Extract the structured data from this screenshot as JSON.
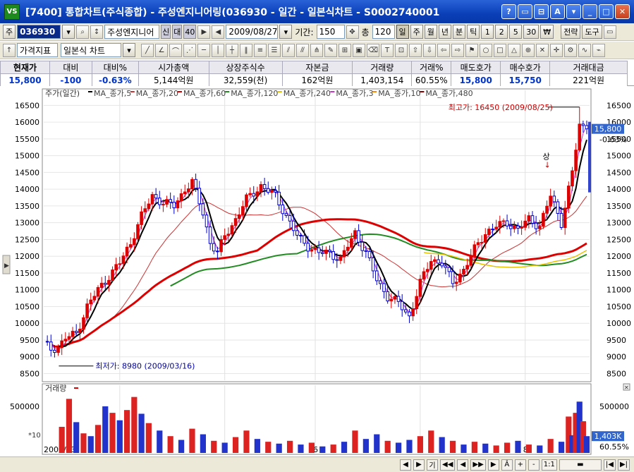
{
  "window": {
    "logo": "VS",
    "title": "[7400] 통합차트(주식종합) - 주성엔지니어링(036930 - 일간 - 일본식차트 - S0002740001",
    "buttons": [
      "?",
      "▭",
      "⊟",
      "A",
      "▾",
      "_",
      "□",
      "✕"
    ]
  },
  "toolbar1": {
    "market": "주",
    "code": "036930",
    "stock_name": "주성엔지니어",
    "tag1": "신",
    "tag2": "대",
    "tag3": "40",
    "date": "2009/08/27",
    "period_label": "기간:",
    "period_value": "150",
    "count_label": "총",
    "count_value": "120",
    "periods": [
      "일",
      "주",
      "월",
      "년",
      "분",
      "틱"
    ],
    "selected_period": "일",
    "minutes": [
      "1",
      "2",
      "5",
      "30"
    ],
    "currency": "₩",
    "strategy": "전략",
    "tools": "도구"
  },
  "toolbar2": {
    "indicator": "가격지표",
    "chart_type": "일본식 차트"
  },
  "info": {
    "headers": [
      "현재가",
      "대비",
      "대비%",
      "시가총액",
      "상장주식수",
      "자본금",
      "거래량",
      "거래%",
      "매도호가",
      "매수호가",
      "거래대금"
    ],
    "values": [
      "15,800",
      "-100",
      "-0.63%",
      "5,144억원",
      "32,559(천)",
      "162억원",
      "1,403,154",
      "60.55%",
      "15,800",
      "15,750",
      "221억원"
    ]
  },
  "chart_data": {
    "type": "candlestick",
    "title": "주가(일간)",
    "legend": [
      {
        "name": "MA_종가,5",
        "color": "#000000"
      },
      {
        "name": "MA_종가,20",
        "color": "#cc3333"
      },
      {
        "name": "MA_종가,60",
        "color": "#dd0000"
      },
      {
        "name": "MA_종가,120",
        "color": "#228b22"
      },
      {
        "name": "MA_종가,240",
        "color": "#e6c200"
      },
      {
        "name": "MA_종가,3",
        "color": "#cc33cc"
      },
      {
        "name": "MA_종가,10",
        "color": "#ff8800"
      },
      {
        "name": "MA_종가,480",
        "color": "#880000"
      }
    ],
    "y_ticks": [
      8500,
      9000,
      9500,
      10000,
      10500,
      11000,
      11500,
      12000,
      12500,
      13000,
      13500,
      14000,
      14500,
      15000,
      15500,
      16000,
      16500
    ],
    "y_range": [
      8300,
      16950
    ],
    "x_labels": [
      "2009/03",
      "4",
      "5",
      "6",
      "7",
      "8"
    ],
    "x_label_days": [
      0,
      21,
      50,
      75,
      104,
      133
    ],
    "day_count": 150,
    "high_label": "최고가: 16450 (2009/08/25)",
    "high_value": 16450,
    "high_day": 148,
    "low_label": "최저가: 8980 (2009/03/16)",
    "low_value": 8980,
    "low_day": 3,
    "current_price": "15,800",
    "current_value": 15800,
    "current_change": "-0.63%",
    "signal_label": "상",
    "anchors": [
      [
        0,
        9400
      ],
      [
        3,
        9150
      ],
      [
        6,
        9550
      ],
      [
        9,
        9700
      ],
      [
        12,
        10500
      ],
      [
        15,
        11000
      ],
      [
        18,
        11400
      ],
      [
        21,
        11800
      ],
      [
        24,
        12400
      ],
      [
        27,
        13200
      ],
      [
        30,
        13800
      ],
      [
        33,
        13600
      ],
      [
        36,
        13500
      ],
      [
        39,
        14000
      ],
      [
        41,
        14200
      ],
      [
        44,
        13300
      ],
      [
        46,
        12400
      ],
      [
        48,
        12100
      ],
      [
        50,
        12600
      ],
      [
        53,
        13100
      ],
      [
        56,
        13700
      ],
      [
        60,
        14100
      ],
      [
        64,
        13800
      ],
      [
        67,
        13200
      ],
      [
        70,
        12600
      ],
      [
        73,
        12300
      ],
      [
        76,
        12100
      ],
      [
        79,
        12100
      ],
      [
        82,
        11900
      ],
      [
        86,
        12700
      ],
      [
        89,
        12100
      ],
      [
        92,
        11300
      ],
      [
        95,
        10800
      ],
      [
        98,
        10600
      ],
      [
        101,
        10200
      ],
      [
        104,
        11200
      ],
      [
        107,
        11900
      ],
      [
        110,
        11800
      ],
      [
        113,
        11200
      ],
      [
        116,
        11600
      ],
      [
        119,
        12200
      ],
      [
        122,
        12700
      ],
      [
        125,
        12900
      ],
      [
        128,
        13000
      ],
      [
        131,
        12800
      ],
      [
        134,
        13100
      ],
      [
        137,
        12900
      ],
      [
        140,
        13800
      ],
      [
        143,
        13000
      ],
      [
        146,
        14500
      ],
      [
        148,
        15900
      ],
      [
        150,
        15800
      ]
    ],
    "volume": {
      "title": "거래량",
      "y_ticks": [
        500000
      ],
      "current": "1,403K",
      "ratio": "60.55%",
      "axis_max": 620000,
      "bars": [
        [
          5,
          280000,
          1
        ],
        [
          7,
          580000,
          1
        ],
        [
          9,
          330000,
          0
        ],
        [
          11,
          210000,
          1
        ],
        [
          13,
          180000,
          0
        ],
        [
          15,
          300000,
          1
        ],
        [
          17,
          500000,
          0
        ],
        [
          19,
          430000,
          1
        ],
        [
          21,
          350000,
          0
        ],
        [
          23,
          460000,
          1
        ],
        [
          25,
          600000,
          1
        ],
        [
          27,
          420000,
          0
        ],
        [
          29,
          320000,
          1
        ],
        [
          32,
          240000,
          0
        ],
        [
          35,
          180000,
          1
        ],
        [
          38,
          140000,
          0
        ],
        [
          41,
          260000,
          1
        ],
        [
          44,
          200000,
          0
        ],
        [
          47,
          130000,
          1
        ],
        [
          50,
          110000,
          0
        ],
        [
          53,
          170000,
          1
        ],
        [
          56,
          240000,
          1
        ],
        [
          59,
          150000,
          0
        ],
        [
          62,
          120000,
          1
        ],
        [
          65,
          100000,
          0
        ],
        [
          68,
          130000,
          1
        ],
        [
          71,
          90000,
          0
        ],
        [
          74,
          110000,
          1
        ],
        [
          77,
          70000,
          0
        ],
        [
          80,
          90000,
          1
        ],
        [
          83,
          120000,
          0
        ],
        [
          86,
          240000,
          1
        ],
        [
          89,
          150000,
          0
        ],
        [
          92,
          200000,
          0
        ],
        [
          95,
          130000,
          1
        ],
        [
          98,
          110000,
          0
        ],
        [
          101,
          140000,
          0
        ],
        [
          104,
          180000,
          1
        ],
        [
          107,
          240000,
          1
        ],
        [
          110,
          170000,
          0
        ],
        [
          113,
          130000,
          1
        ],
        [
          116,
          90000,
          0
        ],
        [
          119,
          120000,
          1
        ],
        [
          122,
          100000,
          0
        ],
        [
          125,
          80000,
          1
        ],
        [
          128,
          110000,
          1
        ],
        [
          131,
          130000,
          0
        ],
        [
          134,
          90000,
          1
        ],
        [
          137,
          80000,
          0
        ],
        [
          140,
          150000,
          1
        ],
        [
          143,
          120000,
          0
        ],
        [
          145,
          390000,
          1
        ],
        [
          146,
          190000,
          0
        ],
        [
          147,
          430000,
          1
        ],
        [
          148,
          550000,
          0
        ],
        [
          149,
          340000,
          1
        ],
        [
          150,
          180000,
          0
        ]
      ]
    }
  },
  "statusbar": {
    "buttons": [
      "◀",
      "▶",
      "기",
      "◀◀",
      "◀",
      "▶▶",
      "▶",
      "Â",
      "+",
      "-",
      "1:1",
      "▬",
      "|◀",
      "▶|"
    ]
  }
}
